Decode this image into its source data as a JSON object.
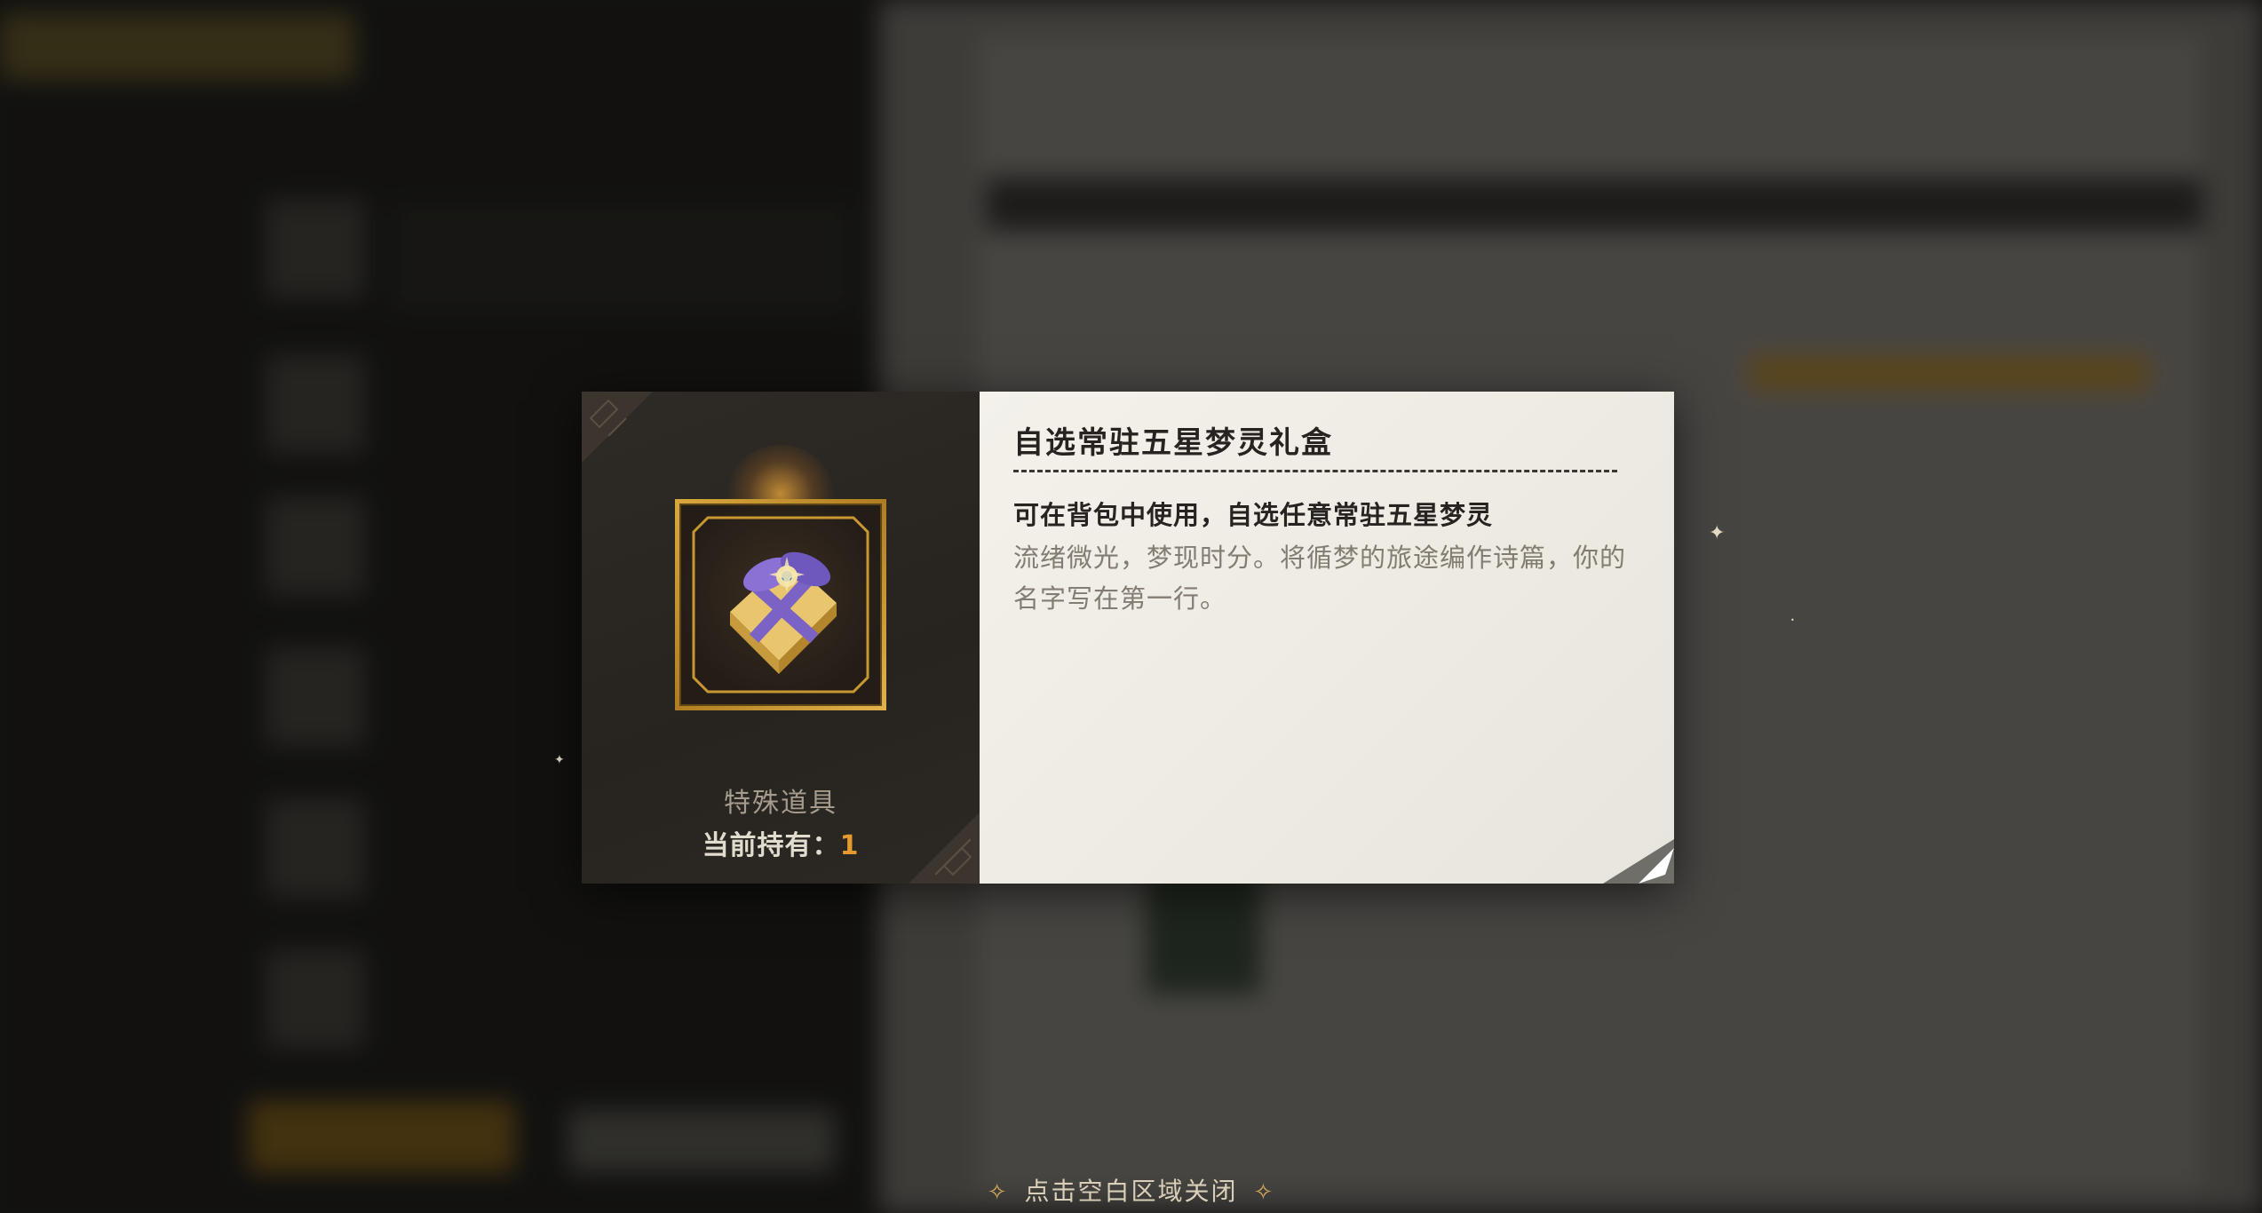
{
  "item": {
    "name": "自选常驻五星梦灵礼盒",
    "usage": "可在背包中使用，自选任意常驻五星梦灵",
    "description": "流绪微光，梦现时分。将循梦的旅途编作诗篇，你的名字写在第一行。",
    "category": "特殊道具",
    "holding_label": "当前持有：",
    "holding_count": "1",
    "icon": "gift-box-icon"
  },
  "footer": {
    "close_hint": "点击空白区域关闭",
    "hint_icon": "diamond-star-icon"
  },
  "colors": {
    "accent_gold": "#d9a83d",
    "count_orange": "#e49a2e",
    "panel_dark": "#2b2723",
    "panel_light": "#f1efe8"
  }
}
